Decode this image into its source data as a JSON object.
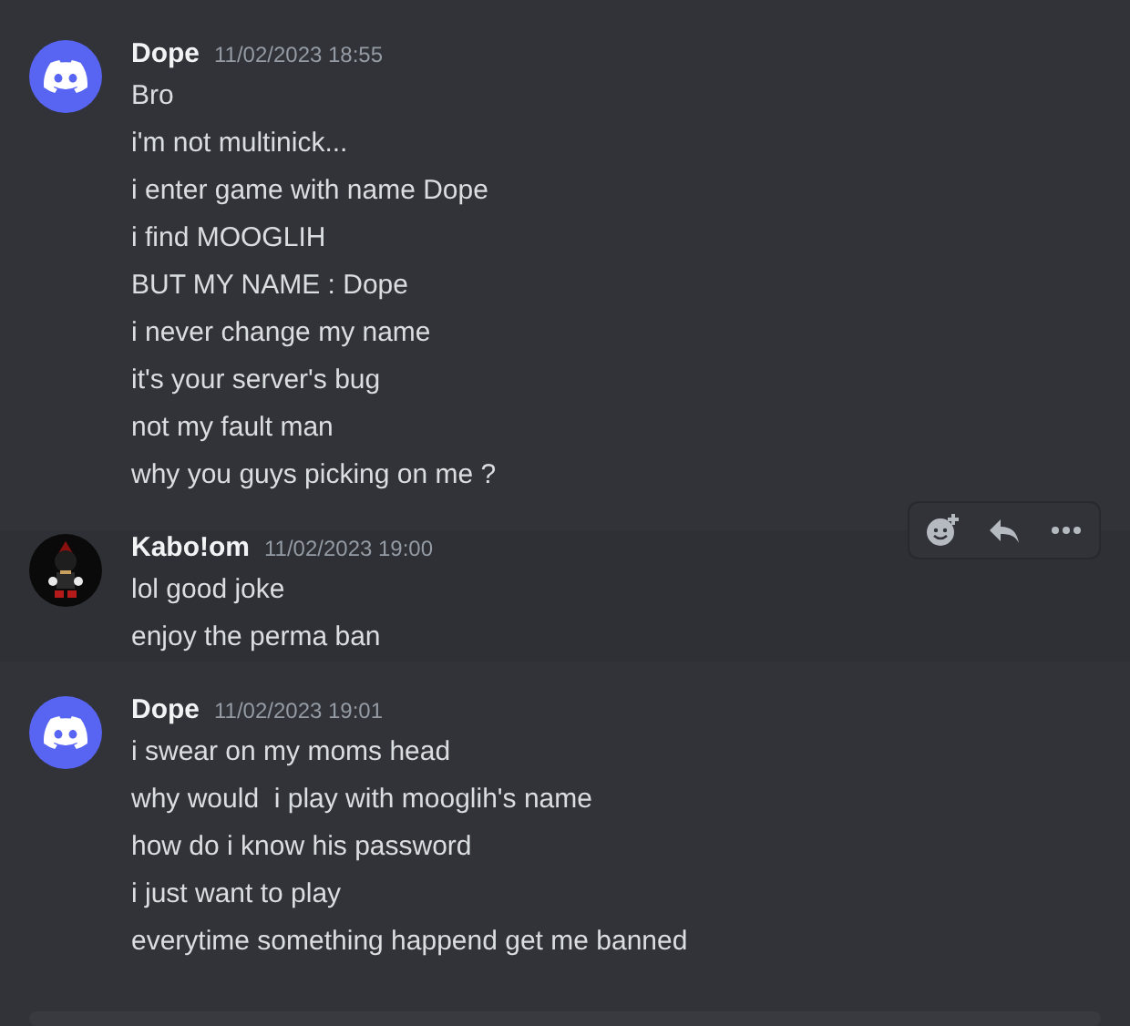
{
  "messages": [
    {
      "author": "Dope",
      "timestamp": "11/02/2023 18:55",
      "kind": "discord",
      "hovered": false,
      "lines": [
        "Bro",
        "i'm not multinick...",
        "i enter game with name Dope",
        "i find MOOGLIH",
        "BUT MY NAME : Dope",
        "i never change my name",
        "it's your server's bug",
        "not my fault man",
        "why you guys picking on me ?"
      ]
    },
    {
      "author": "Kabo!om",
      "timestamp": "11/02/2023 19:00",
      "kind": "picture",
      "hovered": true,
      "lines": [
        "lol good joke",
        "enjoy the perma ban"
      ]
    },
    {
      "author": "Dope",
      "timestamp": "11/02/2023 19:01",
      "kind": "discord",
      "hovered": false,
      "lines": [
        "i swear on my moms head",
        "why would  i play with mooglih's name",
        "how do i know his password",
        "i just want to play",
        "everytime something happend get me banned"
      ]
    }
  ]
}
